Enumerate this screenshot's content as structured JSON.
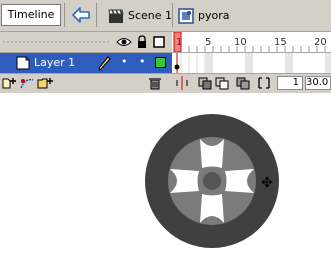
{
  "header": {
    "timeline_label": "Timeline",
    "breadcrumbs": [
      {
        "icon": "scene-clapperboard-icon",
        "label": "Scene 1"
      },
      {
        "icon": "symbol-icon",
        "label": "pyora"
      }
    ]
  },
  "timeline": {
    "ruler_numbers": [
      "1",
      "5",
      "10",
      "15",
      "20"
    ],
    "layer": {
      "name": "Layer 1",
      "visible_dot": "•",
      "lock_dot": "•",
      "outline_color": "#33cc33"
    },
    "current_frame": "1",
    "frame_rate": "30.0"
  },
  "stage": {
    "object": "tire-symbol",
    "colors": {
      "tire": "#404040",
      "rim": "#7b7b7b",
      "spokes": "#ffffff",
      "hub": "#555555"
    }
  }
}
